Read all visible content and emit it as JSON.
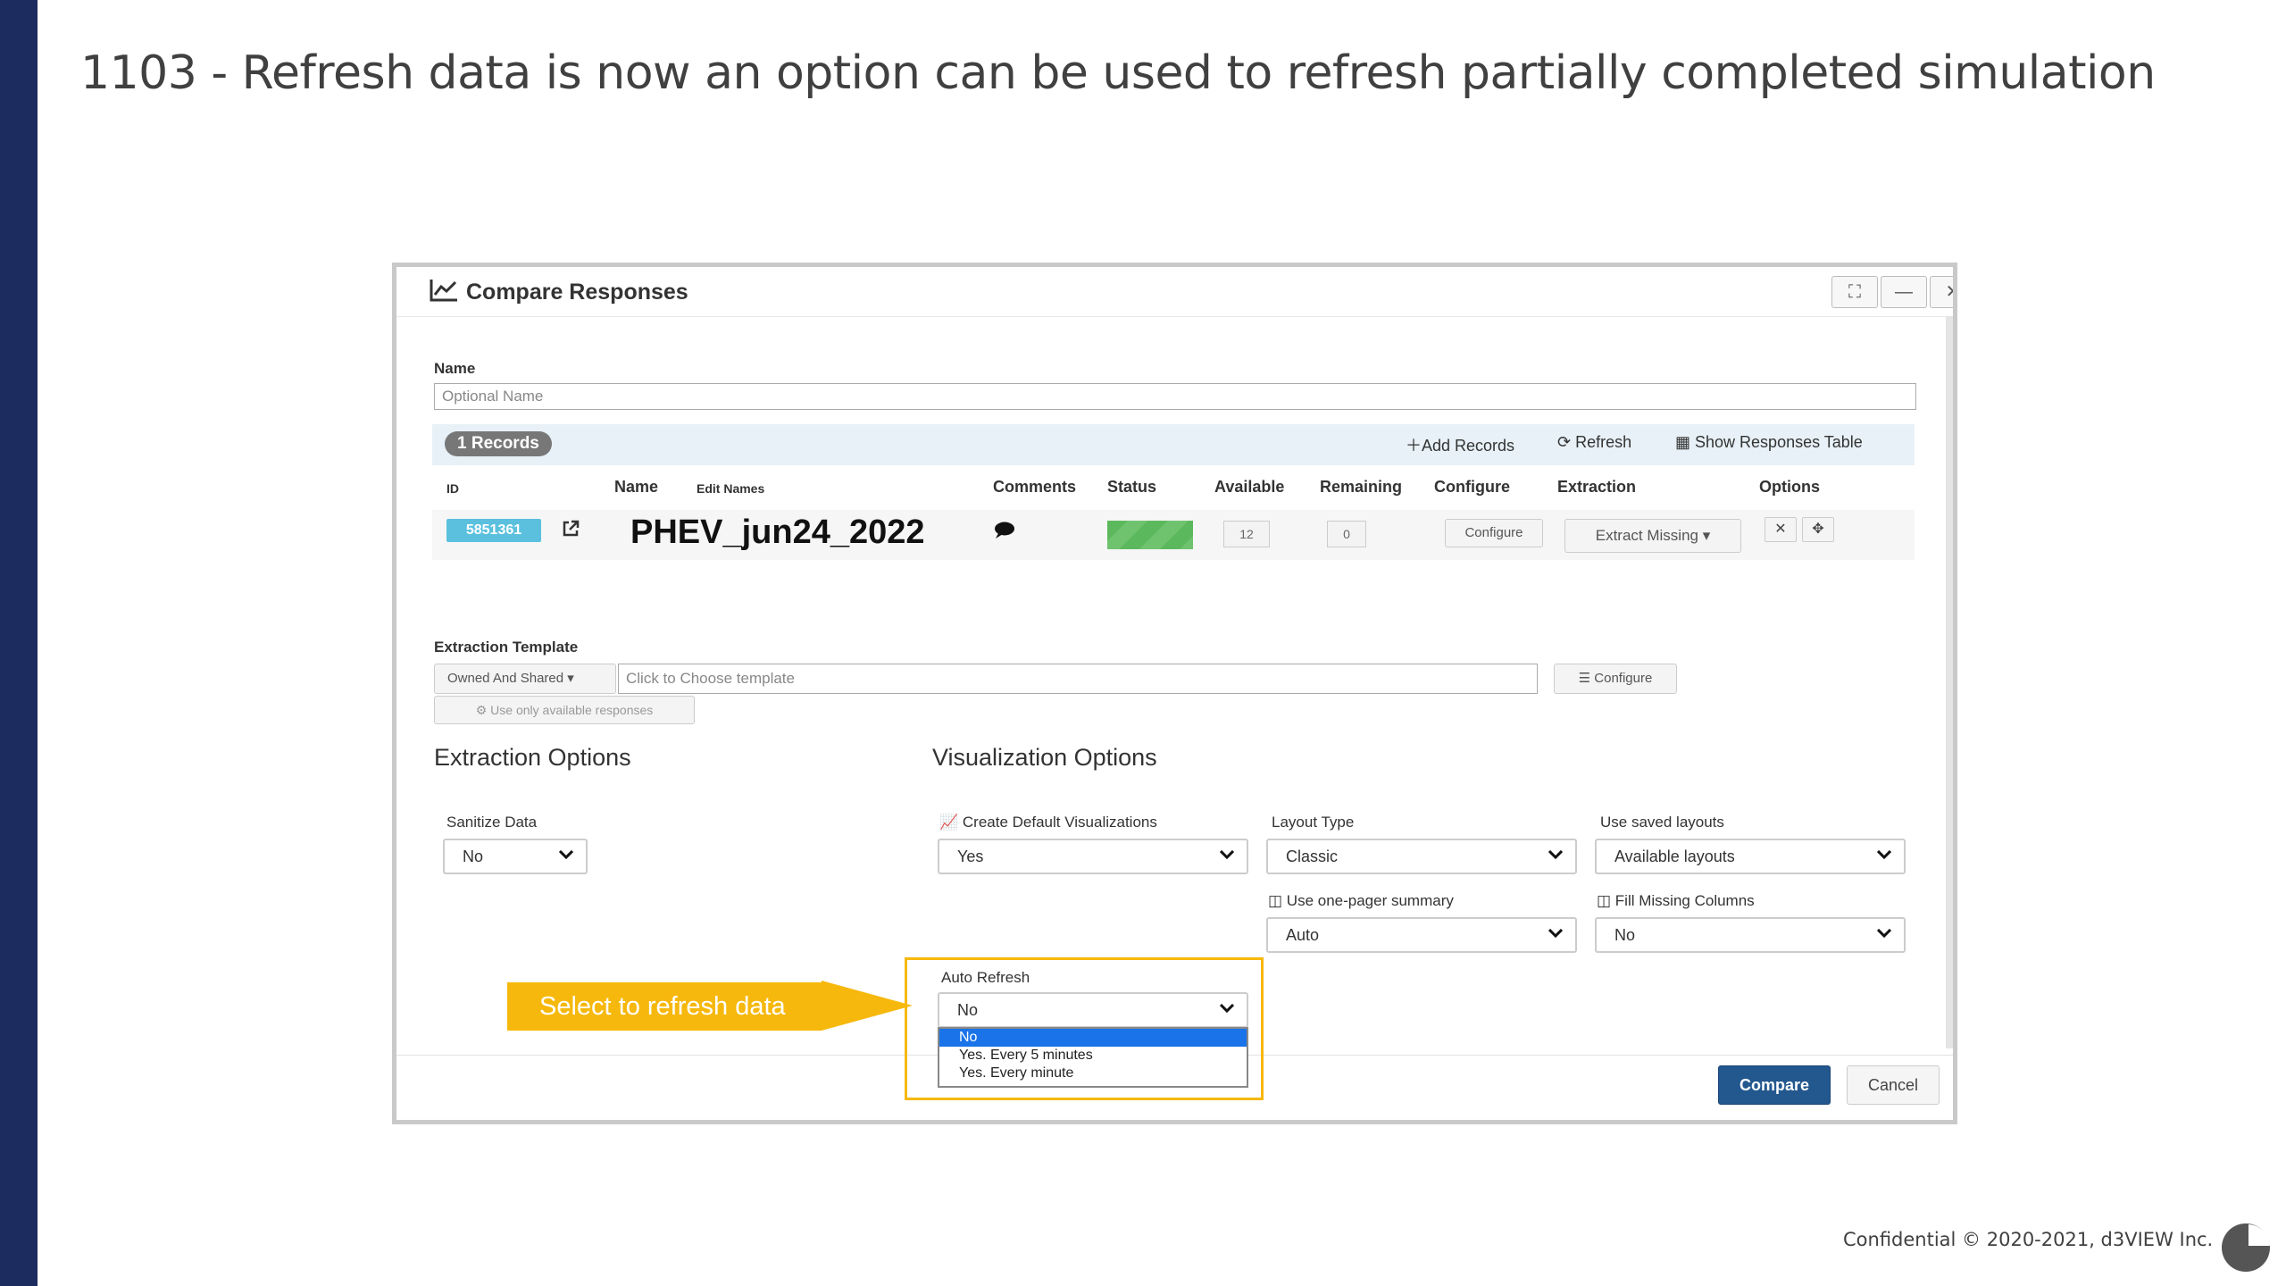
{
  "slide": {
    "title": "1103 - Refresh data is now an option can be used to refresh partially completed simulation",
    "footer": "Confidential © 2020-2021,  d3VIEW Inc.",
    "callout": "Select to refresh data",
    "colors": {
      "sidebar": "#1d2c5e",
      "highlight": "#f6b80c",
      "primary_button": "#23588f",
      "id_badge": "#5bc0de",
      "status": "#5cb85c",
      "dropdown_selected": "#1a73e8"
    }
  },
  "modal": {
    "title": "Compare Responses",
    "title_icon": "line-chart-icon",
    "window_buttons": {
      "expand": "⛶",
      "minimize": "—",
      "close": "✕"
    },
    "name_label": "Name",
    "name_placeholder": "Optional Name",
    "records_badge": "1 Records",
    "actions": {
      "add": "Add Records",
      "refresh": "Refresh",
      "show_table": "Show Responses Table"
    },
    "columns": {
      "id": "ID",
      "name": "Name",
      "edit_names": "Edit Names",
      "comments": "Comments",
      "status": "Status",
      "available": "Available",
      "remaining": "Remaining",
      "configure": "Configure",
      "extraction": "Extraction",
      "options": "Options"
    },
    "record": {
      "id": "5851361",
      "name": "PHEV_jun24_2022",
      "available": "12",
      "remaining": "0",
      "configure_btn": "Configure",
      "extraction_btn": "Extract Missing"
    },
    "extraction_template": {
      "label": "Extraction Template",
      "owner_filter": "Owned And Shared",
      "placeholder": "Click to Choose template",
      "configure_btn": "Configure",
      "use_available_btn": "Use only available responses"
    },
    "extraction_options": {
      "title": "Extraction Options",
      "sanitize_label": "Sanitize Data",
      "sanitize_value": "No"
    },
    "visualization_options": {
      "title": "Visualization Options",
      "create_default_label": "Create Default Visualizations",
      "create_default_value": "Yes",
      "layout_type_label": "Layout Type",
      "layout_type_value": "Classic",
      "saved_layouts_label": "Use saved layouts",
      "saved_layouts_value": "Available layouts",
      "one_pager_label": "Use one-pager summary",
      "one_pager_value": "Auto",
      "fill_missing_label": "Fill Missing Columns",
      "fill_missing_value": "No"
    },
    "auto_refresh": {
      "label": "Auto Refresh",
      "value": "No",
      "options": [
        "No",
        "Yes. Every 5 minutes",
        "Yes. Every minute"
      ],
      "selected_index": 0
    },
    "compare_btn": "Compare",
    "cancel_btn": "Cancel"
  }
}
